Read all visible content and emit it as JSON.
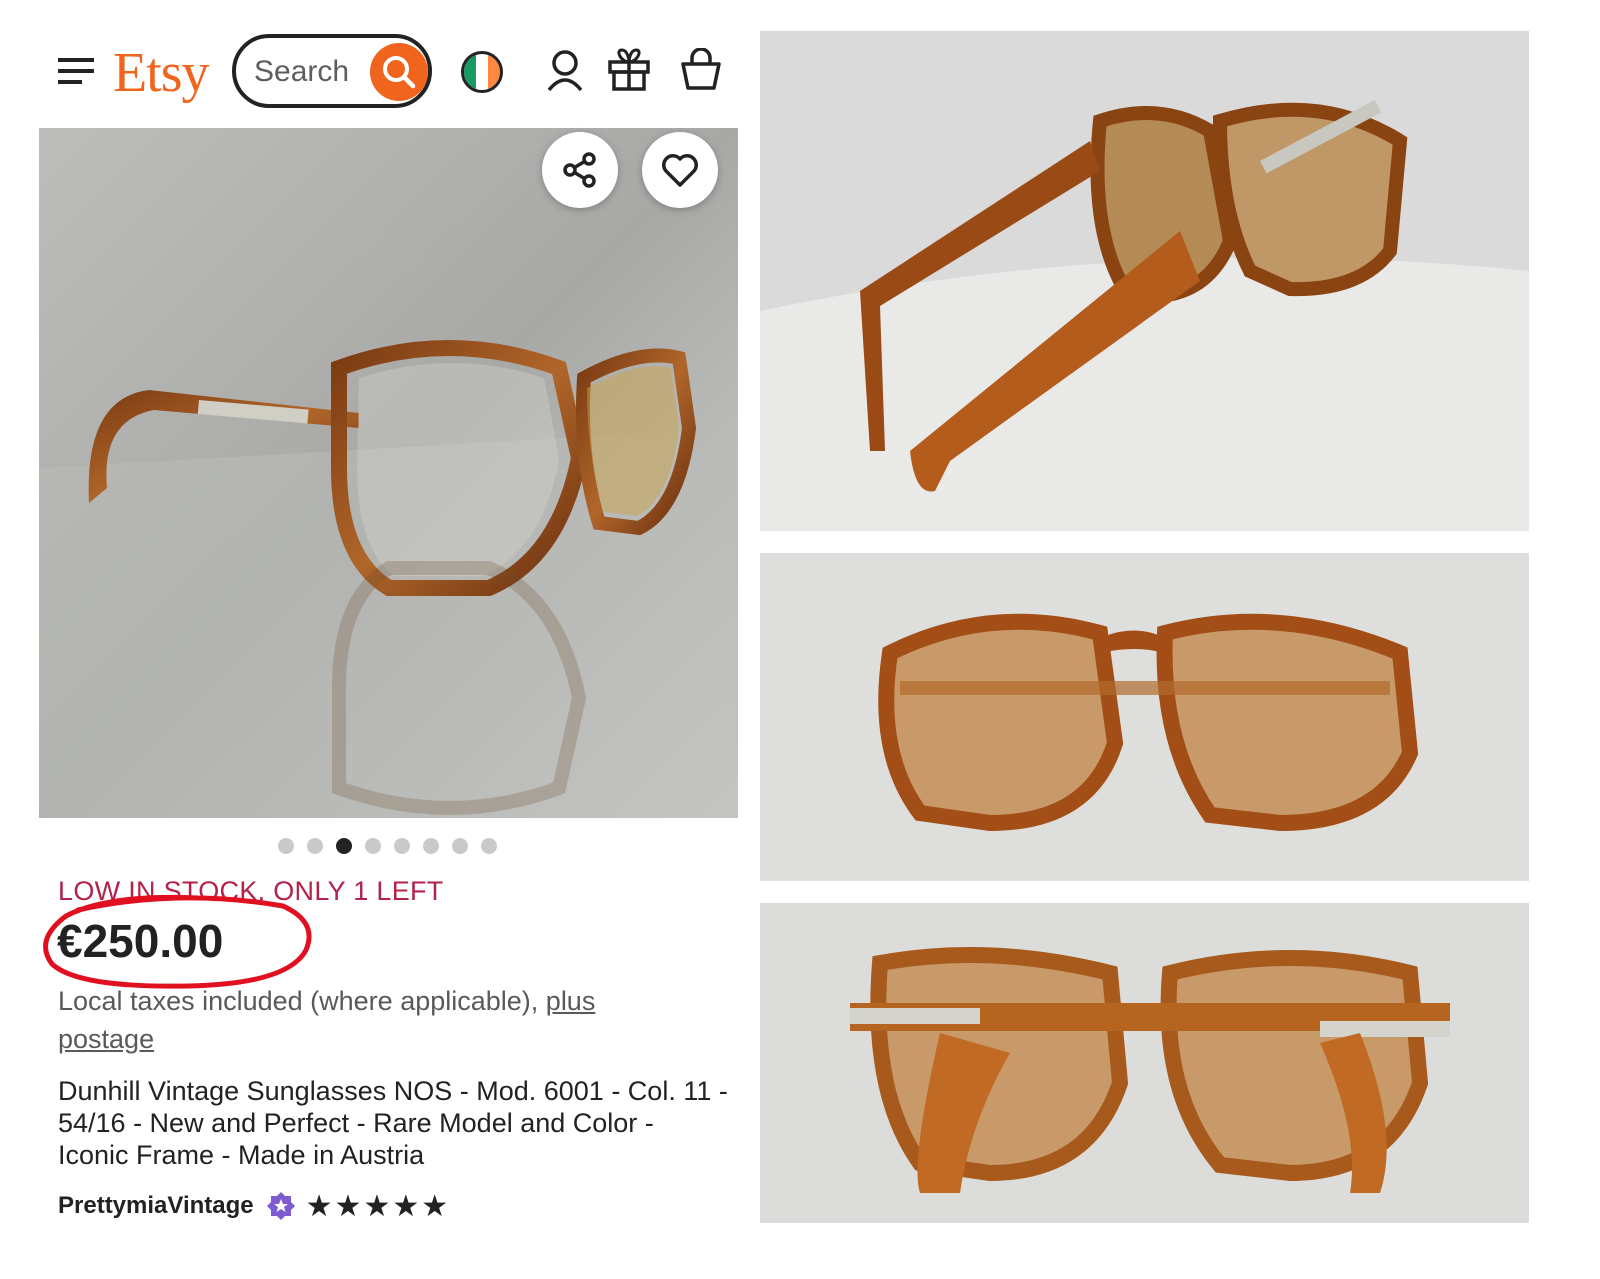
{
  "header": {
    "logo": "Etsy",
    "search_placeholder": "Search",
    "icons": [
      "menu-icon",
      "search-icon",
      "ireland-flag-icon",
      "account-icon",
      "gift-icon",
      "basket-icon"
    ]
  },
  "gallery": {
    "dots_count": 8,
    "active_dot_index": 2
  },
  "listing": {
    "stock_notice": "LOW IN STOCK, ONLY 1 LEFT",
    "price": "€250.00",
    "tax_text": "Local taxes included (where applicable),",
    "postage_link": "plus postage",
    "title": "Dunhill Vintage Sunglasses NOS - Mod. 6001 - Col. 11 - 54/16 - New and Perfect - Rare Model and Color - Iconic Frame - Made in Austria",
    "seller": "PrettymiaVintage",
    "rating_stars": 5
  },
  "colors": {
    "brand": "#f1641e",
    "stock_red": "#b3224a",
    "annotation_red": "#e01020"
  }
}
